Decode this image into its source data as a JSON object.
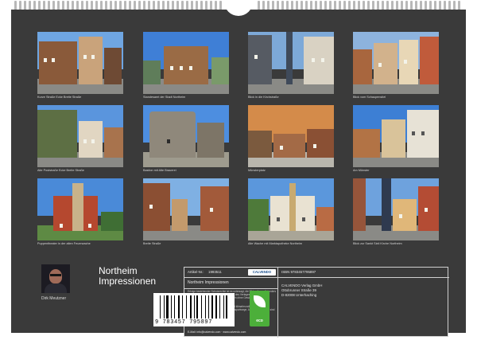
{
  "calendar": {
    "title_line1": "Northeim",
    "title_line2": "Impressionen",
    "author": "Dirk Meutzner"
  },
  "photos": [
    {
      "caption": "Kurze Straße Ecke Breite Straße",
      "sky": "#6fa6e2"
    },
    {
      "caption": "Standesamt der Stadt Northeim",
      "sky": "#3f7fd6"
    },
    {
      "caption": "Blick in die Kirchstraße",
      "sky": "#7da9d8"
    },
    {
      "caption": "Blick vom Schaupenstiel",
      "sky": "#8db3dd"
    },
    {
      "caption": "Alte Poststraße Ecke Breite Straße",
      "sky": "#5a95dd"
    },
    {
      "caption": "Bastion mit Alte Brauerei",
      "sky": "#4d8ee0"
    },
    {
      "caption": "Münsterplatz",
      "sky": "#d48b4a"
    },
    {
      "caption": "Am Münster",
      "sky": "#3d7fd4"
    },
    {
      "caption": "Puppentheater in der alten Feuerwache",
      "sky": "#4a8ad8"
    },
    {
      "caption": "Breite Straße",
      "sky": "#7fb0e3"
    },
    {
      "caption": "Alte Wache mit Marktapotheke Northeim",
      "sky": "#5b97dc"
    },
    {
      "caption": "Blick zur Sankt Sixti Kirche Northeim",
      "sky": "#6ea2dd"
    }
  ],
  "info": {
    "article_label": "Artikel-Nr.:",
    "article_no": "1993511",
    "publisher_badge": "CALVENDO",
    "product_title": "Northeim Impressionen",
    "desc1": "Erfolge bestehender Schutzrechte ist es untersagt, die Bilder dieses Kalenders herauszutrennen und ohne Genehmigung des Verlages zu gewerblichen Zwecken weiterzuverwenden. Alle Angaben ohne Gewähr.",
    "desc2": "CALVENDO produziert verfahrensarm und klimafreundlich in DE & EU. Verbleibende CO2-Werte kann durch Transportwege, Anfall Reduzierung sind Emissionsvermeidung.",
    "email": "E-Mail: info@calvendo.com · www.calvendo.com",
    "isbn": "ISBN 9783457795897",
    "publisher_name": "CALVENDO Verlag GmbH",
    "street": "Ottobrunner Straße 39",
    "city": "D-82008 Unterhaching",
    "barcode_digits": "9 783457 795897",
    "eco_label": "eco"
  }
}
